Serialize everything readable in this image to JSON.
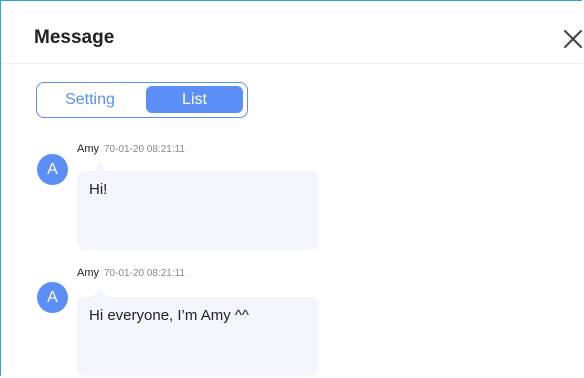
{
  "dialog": {
    "title": "Message",
    "close_icon": "close-icon"
  },
  "tabs": [
    {
      "label": "Setting",
      "selected": false
    },
    {
      "label": "List",
      "selected": true
    }
  ],
  "colors": {
    "accent": "#5b8ff7",
    "bubble_bg": "#f4f5fc",
    "frame_border": "#2aa3e6"
  },
  "messages": [
    {
      "avatar_letter": "A",
      "sender": "Amy",
      "timestamp": "70-01-20 08:21:11",
      "text": "Hi!"
    },
    {
      "avatar_letter": "A",
      "sender": "Amy",
      "timestamp": "70-01-20 08:21:11",
      "text": "Hi everyone, I’m Amy ^^"
    }
  ]
}
